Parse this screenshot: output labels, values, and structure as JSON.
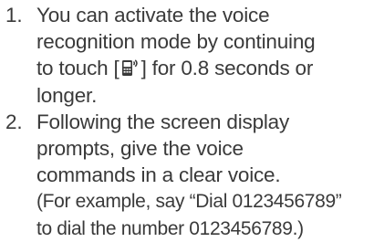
{
  "steps": [
    {
      "number": "1.",
      "lines": [
        "You can activate the voice",
        "recognition mode by continuing",
        "to touch [",
        "] for 0.8 seconds or",
        "longer."
      ]
    },
    {
      "number": "2.",
      "lines": [
        "Following the screen display",
        "prompts, give the voice",
        "commands in a clear voice.",
        "(For example, say “Dial 0123456789”",
        "to dial the number 0123456789.)"
      ]
    }
  ],
  "icons": {
    "voice_key": "phone-voice-icon"
  }
}
